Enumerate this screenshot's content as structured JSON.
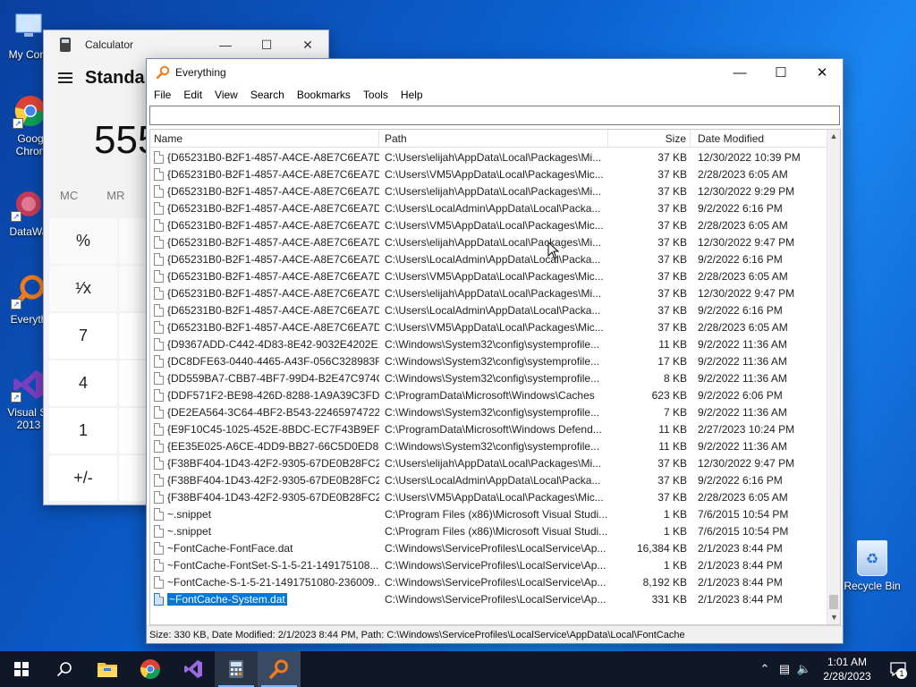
{
  "desktop": {
    "icons": [
      {
        "label": "My Com"
      },
      {
        "label": "Goog\nChron"
      },
      {
        "label": "DataWa"
      },
      {
        "label": "Everyth"
      },
      {
        "label": "Visual St\n2013"
      }
    ],
    "recycle_bin": {
      "label": "Recycle Bin"
    }
  },
  "calculator": {
    "title": "Calculator",
    "mode": "Standar",
    "display": "555",
    "memory": [
      "MC",
      "MR"
    ],
    "keys": [
      "%",
      "",
      "",
      "",
      "¹⁄x",
      "",
      "",
      "",
      "7",
      "",
      "",
      "",
      "4",
      "",
      "",
      "",
      "1",
      "",
      "",
      "",
      "+/-",
      "",
      "",
      ""
    ]
  },
  "everything": {
    "title": "Everything",
    "menu": [
      "File",
      "Edit",
      "View",
      "Search",
      "Bookmarks",
      "Tools",
      "Help"
    ],
    "search_value": "",
    "columns": {
      "name": "Name",
      "path": "Path",
      "size": "Size",
      "date": "Date Modified"
    },
    "rows": [
      {
        "name": "{D65231B0-B2F1-4857-A4CE-A8E7C6EA7D...",
        "path": "C:\\Users\\elijah\\AppData\\Local\\Packages\\Mi...",
        "size": "37 KB",
        "date": "12/30/2022 10:39 PM"
      },
      {
        "name": "{D65231B0-B2F1-4857-A4CE-A8E7C6EA7D...",
        "path": "C:\\Users\\VM5\\AppData\\Local\\Packages\\Mic...",
        "size": "37 KB",
        "date": "2/28/2023 6:05 AM"
      },
      {
        "name": "{D65231B0-B2F1-4857-A4CE-A8E7C6EA7D...",
        "path": "C:\\Users\\elijah\\AppData\\Local\\Packages\\Mi...",
        "size": "37 KB",
        "date": "12/30/2022 9:29 PM"
      },
      {
        "name": "{D65231B0-B2F1-4857-A4CE-A8E7C6EA7D...",
        "path": "C:\\Users\\LocalAdmin\\AppData\\Local\\Packa...",
        "size": "37 KB",
        "date": "9/2/2022 6:16 PM"
      },
      {
        "name": "{D65231B0-B2F1-4857-A4CE-A8E7C6EA7D...",
        "path": "C:\\Users\\VM5\\AppData\\Local\\Packages\\Mic...",
        "size": "37 KB",
        "date": "2/28/2023 6:05 AM"
      },
      {
        "name": "{D65231B0-B2F1-4857-A4CE-A8E7C6EA7D...",
        "path": "C:\\Users\\elijah\\AppData\\Local\\Packages\\Mi...",
        "size": "37 KB",
        "date": "12/30/2022 9:47 PM"
      },
      {
        "name": "{D65231B0-B2F1-4857-A4CE-A8E7C6EA7D...",
        "path": "C:\\Users\\LocalAdmin\\AppData\\Local\\Packa...",
        "size": "37 KB",
        "date": "9/2/2022 6:16 PM"
      },
      {
        "name": "{D65231B0-B2F1-4857-A4CE-A8E7C6EA7D...",
        "path": "C:\\Users\\VM5\\AppData\\Local\\Packages\\Mic...",
        "size": "37 KB",
        "date": "2/28/2023 6:05 AM"
      },
      {
        "name": "{D65231B0-B2F1-4857-A4CE-A8E7C6EA7D...",
        "path": "C:\\Users\\elijah\\AppData\\Local\\Packages\\Mi...",
        "size": "37 KB",
        "date": "12/30/2022 9:47 PM"
      },
      {
        "name": "{D65231B0-B2F1-4857-A4CE-A8E7C6EA7D...",
        "path": "C:\\Users\\LocalAdmin\\AppData\\Local\\Packa...",
        "size": "37 KB",
        "date": "9/2/2022 6:16 PM"
      },
      {
        "name": "{D65231B0-B2F1-4857-A4CE-A8E7C6EA7D...",
        "path": "C:\\Users\\VM5\\AppData\\Local\\Packages\\Mic...",
        "size": "37 KB",
        "date": "2/28/2023 6:05 AM"
      },
      {
        "name": "{D9367ADD-C442-4D83-8E42-9032E4202E...",
        "path": "C:\\Windows\\System32\\config\\systemprofile...",
        "size": "11 KB",
        "date": "9/2/2022 11:36 AM"
      },
      {
        "name": "{DC8DFE63-0440-4465-A43F-056C328983F...",
        "path": "C:\\Windows\\System32\\config\\systemprofile...",
        "size": "17 KB",
        "date": "9/2/2022 11:36 AM"
      },
      {
        "name": "{DD559BA7-CBB7-4BF7-99D4-B2E47C974C...",
        "path": "C:\\Windows\\System32\\config\\systemprofile...",
        "size": "8 KB",
        "date": "9/2/2022 11:36 AM"
      },
      {
        "name": "{DDF571F2-BE98-426D-8288-1A9A39C3FD...",
        "path": "C:\\ProgramData\\Microsoft\\Windows\\Caches",
        "size": "623 KB",
        "date": "9/2/2022 6:06 PM"
      },
      {
        "name": "{DE2EA564-3C64-4BF2-B543-22465974722...",
        "path": "C:\\Windows\\System32\\config\\systemprofile...",
        "size": "7 KB",
        "date": "9/2/2022 11:36 AM"
      },
      {
        "name": "{E9F10C45-1025-452E-8BDC-EC7F43B9EF30}",
        "path": "C:\\ProgramData\\Microsoft\\Windows Defend...",
        "size": "11 KB",
        "date": "2/27/2023 10:24 PM"
      },
      {
        "name": "{EE35E025-A6CE-4DD9-BB27-66C5D0ED86...",
        "path": "C:\\Windows\\System32\\config\\systemprofile...",
        "size": "11 KB",
        "date": "9/2/2022 11:36 AM"
      },
      {
        "name": "{F38BF404-1D43-42F2-9305-67DE0B28FC2...",
        "path": "C:\\Users\\elijah\\AppData\\Local\\Packages\\Mi...",
        "size": "37 KB",
        "date": "12/30/2022 9:47 PM"
      },
      {
        "name": "{F38BF404-1D43-42F2-9305-67DE0B28FC2...",
        "path": "C:\\Users\\LocalAdmin\\AppData\\Local\\Packa...",
        "size": "37 KB",
        "date": "9/2/2022 6:16 PM"
      },
      {
        "name": "{F38BF404-1D43-42F2-9305-67DE0B28FC2...",
        "path": "C:\\Users\\VM5\\AppData\\Local\\Packages\\Mic...",
        "size": "37 KB",
        "date": "2/28/2023 6:05 AM"
      },
      {
        "name": "~.snippet",
        "path": "C:\\Program Files (x86)\\Microsoft Visual Studi...",
        "size": "1 KB",
        "date": "7/6/2015 10:54 PM"
      },
      {
        "name": "~.snippet",
        "path": "C:\\Program Files (x86)\\Microsoft Visual Studi...",
        "size": "1 KB",
        "date": "7/6/2015 10:54 PM"
      },
      {
        "name": "~FontCache-FontFace.dat",
        "path": "C:\\Windows\\ServiceProfiles\\LocalService\\Ap...",
        "size": "16,384 KB",
        "date": "2/1/2023 8:44 PM"
      },
      {
        "name": "~FontCache-FontSet-S-1-5-21-149175108...",
        "path": "C:\\Windows\\ServiceProfiles\\LocalService\\Ap...",
        "size": "1 KB",
        "date": "2/1/2023 8:44 PM"
      },
      {
        "name": "~FontCache-S-1-5-21-1491751080-236009...",
        "path": "C:\\Windows\\ServiceProfiles\\LocalService\\Ap...",
        "size": "8,192 KB",
        "date": "2/1/2023 8:44 PM"
      },
      {
        "name": "~FontCache-System.dat",
        "path": "C:\\Windows\\ServiceProfiles\\LocalService\\Ap...",
        "size": "331 KB",
        "date": "2/1/2023 8:44 PM",
        "selected": true
      }
    ],
    "status": "Size: 330 KB, Date Modified: 2/1/2023 8:44 PM, Path: C:\\Windows\\ServiceProfiles\\LocalService\\AppData\\Local\\FontCache"
  },
  "taskbar": {
    "apps": [
      "start-icon",
      "search-icon",
      "file-explorer-icon",
      "chrome-icon",
      "visual-studio-icon",
      "calculator-icon",
      "everything-icon"
    ],
    "time": "1:01 AM",
    "date": "2/28/2023",
    "notification_count": "1"
  }
}
